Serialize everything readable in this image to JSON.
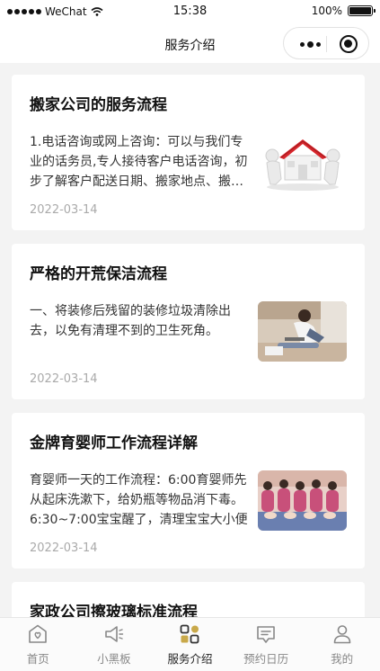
{
  "status_bar": {
    "carrier": "WeChat",
    "time": "15:38",
    "battery": "100%",
    "battery_level": 1.0
  },
  "nav": {
    "title": "服务介绍"
  },
  "articles": [
    {
      "title": "搬家公司的服务流程",
      "summary": "1.电话咨询或网上咨询：可以与我们专业的话务员,专人接待客户电话咨询，初步了解客户配送日期、搬家地点、搬家物品",
      "date": "2022-03-14",
      "thumb_icon": "house-moving-image"
    },
    {
      "title": "严格的开荒保洁流程",
      "summary": "一、将装修后残留的装修垃圾清除出去，以免有清理不到的卫生死角。",
      "date": "2022-03-14",
      "thumb_icon": "cleaning-worker-image"
    },
    {
      "title": "金牌育婴师工作流程详解",
      "summary": "育婴师一天的工作流程：6:00育婴师先从起床洗漱下，给奶瓶等物品消下毒。6:30~7:00宝宝醒了，清理宝宝大小便",
      "date": "2022-03-14",
      "thumb_icon": "nanny-training-image"
    },
    {
      "title": "家政公司擦玻璃标准流程",
      "summary": "",
      "date": "",
      "thumb_icon": ""
    }
  ],
  "tabs": [
    {
      "label": "首页",
      "icon": "home-icon"
    },
    {
      "label": "小黑板",
      "icon": "megaphone-icon"
    },
    {
      "label": "服务介绍",
      "icon": "grid-icon"
    },
    {
      "label": "预约日历",
      "icon": "calendar-message-icon"
    },
    {
      "label": "我的",
      "icon": "user-icon"
    }
  ]
}
